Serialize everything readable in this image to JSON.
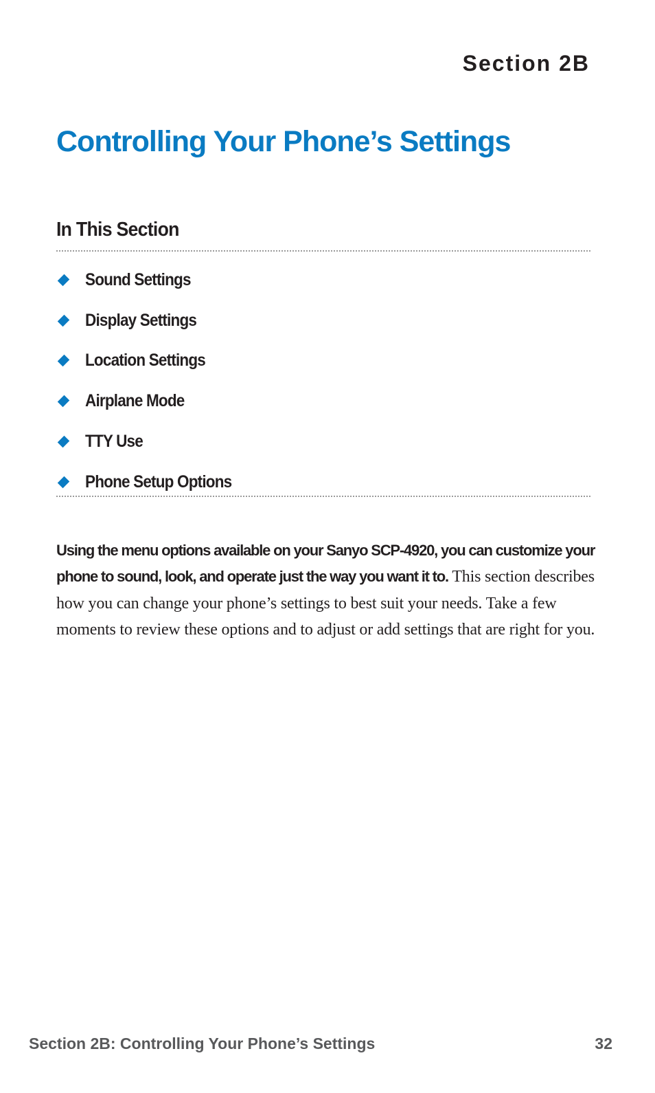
{
  "header": {
    "section_label": "Section 2B",
    "title": "Controlling Your Phone’s Settings"
  },
  "in_this_section": {
    "heading": "In This Section",
    "items": [
      {
        "label": "Sound Settings",
        "bullet_icon": "diamond-bullet"
      },
      {
        "label": "Display Settings",
        "bullet_icon": "diamond-bullet"
      },
      {
        "label": "Location Settings",
        "bullet_icon": "diamond-bullet"
      },
      {
        "label": "Airplane Mode",
        "bullet_icon": "diamond-bullet"
      },
      {
        "label": "TTY Use",
        "bullet_icon": "diamond-bullet"
      },
      {
        "label": "Phone Setup Options",
        "bullet_icon": "diamond-bullet"
      }
    ]
  },
  "intro": {
    "lead_bold": "Using the menu options available on your Sanyo SCP-4920, you can customize your phone to sound, look, and operate just the way you want it to.",
    "body": " This section describes how you can change your phone’s settings to best suit your needs. Take a few moments to review these options and to adjust or add settings that are right for you."
  },
  "footer": {
    "running_title": "Section 2B: Controlling Your Phone’s Settings",
    "page_number": "32"
  },
  "colors": {
    "accent_blue": "#0a7bc2",
    "text": "#231f20",
    "footer_gray": "#58595b",
    "rule_gray": "#9a9a9a"
  }
}
